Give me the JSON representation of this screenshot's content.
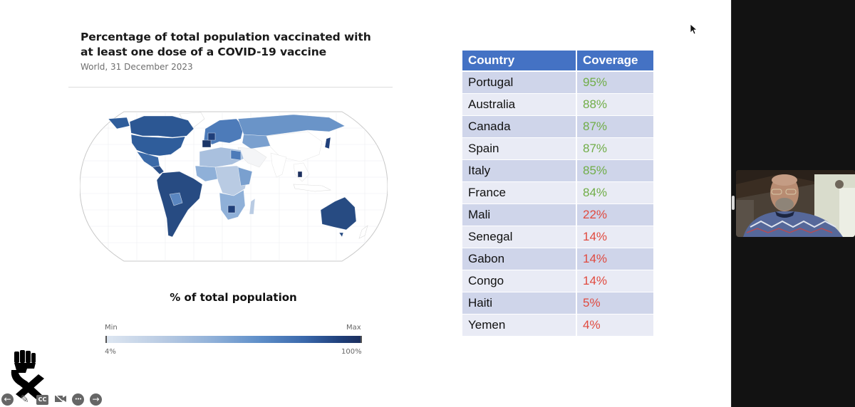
{
  "slide": {
    "chart": {
      "title": "Percentage of total population vaccinated with at least one dose of a COVID-19 vaccine",
      "subtitle": "World, 31 December 2023",
      "legend": {
        "title": "% of total population",
        "min_label": "Min",
        "max_label": "Max",
        "min_value": "4%",
        "max_value": "100%",
        "color_low": "#dde6f1",
        "color_high": "#1c2f5e"
      }
    },
    "table": {
      "headers": [
        "Country",
        "Coverage"
      ],
      "header_color": "#4472c4",
      "high_color": "#70ad47",
      "low_color": "#e04a3f",
      "rows": [
        {
          "country": "Portugal",
          "coverage": "95%",
          "level": "high"
        },
        {
          "country": "Australia",
          "coverage": "88%",
          "level": "high"
        },
        {
          "country": "Canada",
          "coverage": "87%",
          "level": "high"
        },
        {
          "country": "Spain",
          "coverage": "87%",
          "level": "high"
        },
        {
          "country": "Italy",
          "coverage": "85%",
          "level": "high"
        },
        {
          "country": "France",
          "coverage": "84%",
          "level": "high"
        },
        {
          "country": "Mali",
          "coverage": "22%",
          "level": "low"
        },
        {
          "country": "Senegal",
          "coverage": "14%",
          "level": "low"
        },
        {
          "country": "Gabon",
          "coverage": "14%",
          "level": "low"
        },
        {
          "country": "Congo",
          "coverage": "14%",
          "level": "low"
        },
        {
          "country": "Haiti",
          "coverage": "5%",
          "level": "low"
        },
        {
          "country": "Yemen",
          "coverage": "4%",
          "level": "low"
        }
      ]
    },
    "controls": [
      {
        "name": "previous-slide-button",
        "icon": "arrow-left-icon",
        "glyph": "←"
      },
      {
        "name": "pen-tool-button",
        "icon": "pen-icon",
        "glyph": "✎"
      },
      {
        "name": "captions-button",
        "icon": "closed-captions-icon",
        "glyph": "CC"
      },
      {
        "name": "camera-toggle-button",
        "icon": "camera-off-icon",
        "glyph": "◼"
      },
      {
        "name": "more-options-button",
        "icon": "more-icon",
        "glyph": "•••"
      },
      {
        "name": "next-slide-button",
        "icon": "arrow-right-icon",
        "glyph": "→"
      }
    ]
  },
  "participant_panel": {
    "video_tiles": [
      {
        "label": "presenter video"
      }
    ]
  }
}
